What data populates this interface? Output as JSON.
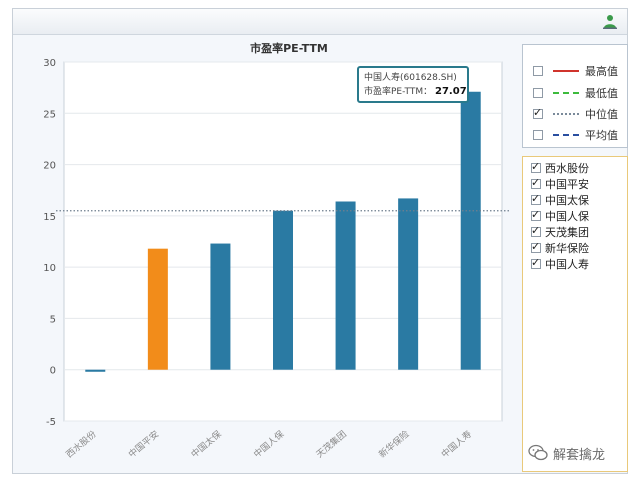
{
  "chart_data": {
    "type": "bar",
    "title": "市盈率PE-TTM",
    "categories": [
      "西水股份",
      "中国平安",
      "中国太保",
      "中国人保",
      "天茂集团",
      "新华保险",
      "中国人寿"
    ],
    "values": [
      -0.2,
      11.8,
      12.3,
      15.5,
      16.4,
      16.7,
      27.1
    ],
    "colors": [
      "#2a7aa3",
      "#f28c1a",
      "#2a7aa3",
      "#2a7aa3",
      "#2a7aa3",
      "#2a7aa3",
      "#2a7aa3"
    ],
    "ylim": [
      -5,
      30
    ],
    "yticks": [
      -5,
      0,
      5,
      10,
      15,
      20,
      25,
      30
    ],
    "grid": true,
    "median_line": 15.5,
    "legend_position": "right"
  },
  "tooltip": {
    "name": "中国人寿(601628.SH)",
    "label": "市盈率PE-TTM：",
    "value": "27.07"
  },
  "legend": {
    "items": [
      {
        "label": "最高值",
        "checked": false,
        "color": "#d0342c",
        "style": "solid"
      },
      {
        "label": "最低值",
        "checked": false,
        "color": "#3dbb3d",
        "style": "dashdot"
      },
      {
        "label": "中位值",
        "checked": true,
        "color": "#7a8a9a",
        "style": "dotted"
      },
      {
        "label": "平均值",
        "checked": false,
        "color": "#2a4fa0",
        "style": "dashed"
      }
    ]
  },
  "series_list": {
    "items": [
      {
        "label": "西水股份",
        "checked": true
      },
      {
        "label": "中国平安",
        "checked": true
      },
      {
        "label": "中国太保",
        "checked": true
      },
      {
        "label": "中国人保",
        "checked": true
      },
      {
        "label": "天茂集团",
        "checked": true
      },
      {
        "label": "新华保险",
        "checked": true
      },
      {
        "label": "中国人寿",
        "checked": true
      }
    ]
  },
  "watermark": {
    "text": "解套擒龙",
    "icon": "wechat-icon"
  },
  "toolbar": {
    "icon": "user-icon"
  }
}
